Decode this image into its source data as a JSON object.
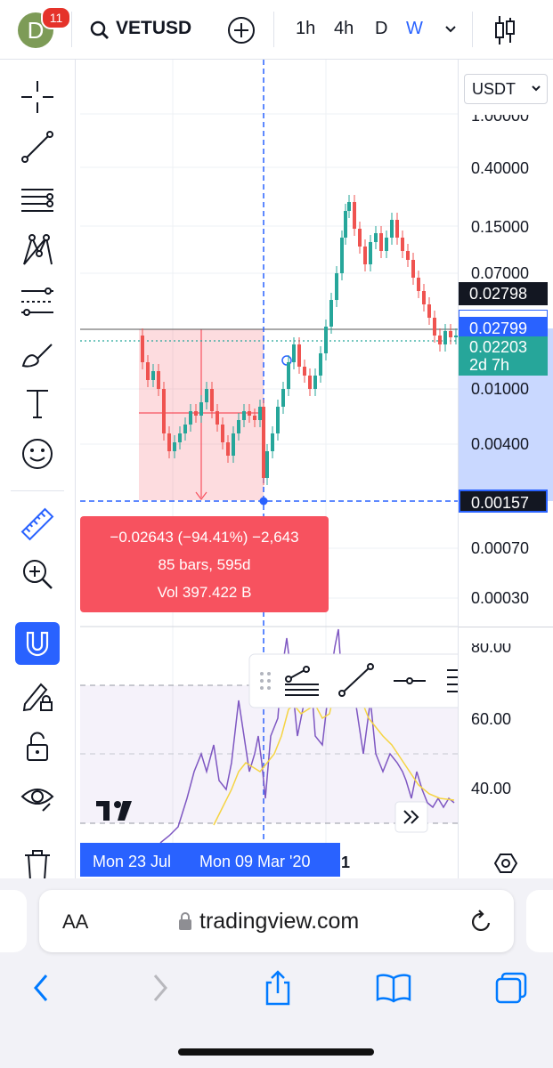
{
  "header": {
    "avatar_letter": "D",
    "notifications": "11",
    "symbol": "VETUSD",
    "timeframes": [
      "1h",
      "4h",
      "D",
      "W"
    ],
    "active_timeframe": "W"
  },
  "toolbar": {
    "tools": [
      "crosshair-icon",
      "trend-line-icon",
      "fib-retracement-icon",
      "pattern-icon",
      "forecast-icon",
      "brush-icon",
      "text-icon",
      "emoji-icon",
      "ruler-icon",
      "zoom-in-icon",
      "magnet-icon",
      "pencil-lock-icon",
      "lock-icon",
      "eye-icon",
      "trash-icon"
    ],
    "active_tool": "magnet-icon"
  },
  "price_axis": {
    "currency": "USDT",
    "ticks": [
      "1.00000",
      "0.40000",
      "0.15000",
      "0.07000",
      "0.01000",
      "0.00400",
      "0.00070",
      "0.00030"
    ],
    "last_price_label": "0.02798",
    "cursor_price_label": "0.02799",
    "alt_price_label": "0.02203",
    "countdown": "2d 7h",
    "measure_low_label": "0.00157",
    "indicator_ticks": [
      "80.00",
      "60.00",
      "40.00"
    ]
  },
  "measure": {
    "line1": "−0.02643 (−94.41%) −2,643",
    "line2": "85 bars, 595d",
    "line3": "Vol 397.422 B"
  },
  "dates": {
    "start": "Mon 23 Jul",
    "end": "Mon 09 Mar '20",
    "trailing": "1"
  },
  "browser": {
    "text_size": "AA",
    "url": "tradingview.com"
  },
  "colors": {
    "accent": "#2962ff",
    "up": "#26a69a",
    "down": "#ef5350",
    "measure": "#f7525f",
    "rsi": "#7e57c2",
    "rsi_ma": "#f5d442"
  }
}
